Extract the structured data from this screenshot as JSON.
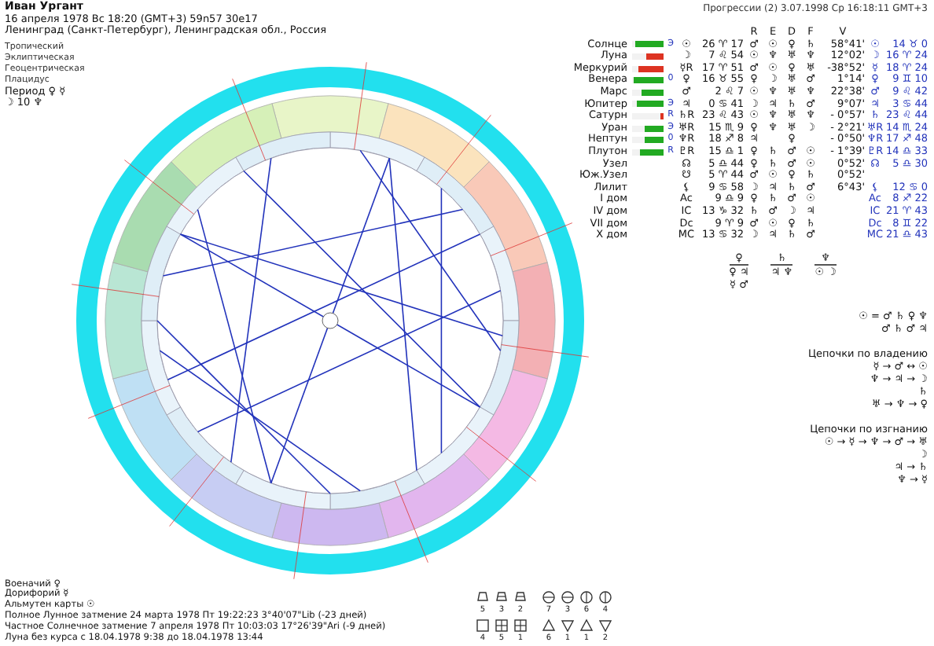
{
  "person": {
    "name": "Иван Ургант",
    "birth": "16 апреля 1978  Вс  18:20 (GMT+3) 59n57  30e17",
    "place": "Ленинград (Санкт-Петербург), Ленинградская обл., Россия"
  },
  "settings": [
    "Тропический",
    "Эклиптическая",
    "Геоцентрическая",
    "Плацидус"
  ],
  "period": {
    "label": "Период",
    "value": "♀ ☿"
  },
  "moon_day": "☽ 10 ♆",
  "progression_title": "Прогрессии (2)  3.07.1998  Ср 16:18:11 GMT+3",
  "table": {
    "columns": [
      "R",
      "E",
      "D",
      "F",
      "V"
    ],
    "rows": [
      {
        "name": "Солнце",
        "level": 0.9,
        "color": "#22aa22",
        "status": "Э",
        "glyph": "☉",
        "position": "26 ♈ 17",
        "r": "♂",
        "e": "☉",
        "d": "♀",
        "f": "♄",
        "v": "58°41'",
        "p_glyph": "☉",
        "p_position": "14 ♉ 0"
      },
      {
        "name": "Луна",
        "level": 0.55,
        "color": "#dd3322",
        "glyph": "☽",
        "position": "7 ♌ 54",
        "r": "☉",
        "e": "♆",
        "d": "♅",
        "f": "♆",
        "v": "12°02'",
        "p_glyph": "☽",
        "p_position": "16 ♈ 24"
      },
      {
        "name": "Меркурий",
        "level": 0.8,
        "color": "#dd3322",
        "glyph": "☿R",
        "position": "17 ♈ 51",
        "r": "♂",
        "e": "☉",
        "d": "♀",
        "f": "♅",
        "v": "-38°52'",
        "p_glyph": "☿",
        "p_position": "18 ♈ 24"
      },
      {
        "name": "Венера",
        "level": 0.95,
        "color": "#22aa22",
        "status": "0",
        "glyph": "♀",
        "position": "16 ♉ 55",
        "r": "♀",
        "e": "☽",
        "d": "♅",
        "f": "♂",
        "v": "1°14'",
        "p_glyph": "♀",
        "p_position": "9 ♊ 10"
      },
      {
        "name": "Марс",
        "level": 0.7,
        "color": "#22aa22",
        "glyph": "♂",
        "position": "2 ♌ 7",
        "r": "☉",
        "e": "♆",
        "d": "♅",
        "f": "♆",
        "v": "22°38'",
        "p_glyph": "♂",
        "p_position": "9 ♌ 42"
      },
      {
        "name": "Юпитер",
        "level": 0.85,
        "color": "#22aa22",
        "status": "Э",
        "glyph": "♃",
        "position": "0 ♋ 41",
        "r": "☽",
        "e": "♃",
        "d": "♄",
        "f": "♂",
        "v": "9°07'",
        "p_glyph": "♃",
        "p_position": "3 ♋ 44"
      },
      {
        "name": "Сатурн",
        "level": 0.1,
        "color": "#dd3322",
        "status": "R",
        "glyph": "♄R",
        "position": "23 ♌ 43",
        "r": "☉",
        "e": "♆",
        "d": "♅",
        "f": "♆",
        "v": "- 0°57'",
        "p_glyph": "♄",
        "p_position": "23 ♌ 44"
      },
      {
        "name": "Уран",
        "level": 0.6,
        "color": "#22aa22",
        "status": "Э",
        "glyph": "♅R",
        "position": "15 ♏ 9",
        "r": "♀",
        "e": "♆",
        "d": "♅",
        "f": "☽",
        "v": "- 2°21'",
        "p_glyph": "♅R",
        "p_position": "14 ♏ 24"
      },
      {
        "name": "Нептун",
        "level": 0.6,
        "color": "#22aa22",
        "status": "0",
        "glyph": "♆R",
        "position": "18 ♐ 8",
        "r": "♃",
        "e": "",
        "d": "♀",
        "f": "",
        "v": "- 0°50'",
        "p_glyph": "♆R",
        "p_position": "17 ♐ 48"
      },
      {
        "name": "Плутон",
        "level": 0.75,
        "color": "#22aa22",
        "status": "R",
        "glyph": "♇R",
        "position": "15 ♎ 1",
        "r": "♀",
        "e": "♄",
        "d": "♂",
        "f": "☉",
        "v": "- 1°39'",
        "p_glyph": "♇R",
        "p_position": "14 ♎ 33"
      },
      {
        "name": "Узел",
        "glyph": "☊",
        "position": "5 ♎ 44",
        "r": "♀",
        "e": "♄",
        "d": "♂",
        "f": "☉",
        "v": "0°52'",
        "p_glyph": "☊",
        "p_position": "5 ♎ 30"
      },
      {
        "name": "Юж.Узел",
        "glyph": "☋",
        "position": "5 ♈ 44",
        "r": "♂",
        "e": "☉",
        "d": "♀",
        "f": "♄",
        "v": "0°52'"
      },
      {
        "name": "Лилит",
        "glyph": "⚸",
        "position": "9 ♋ 58",
        "r": "☽",
        "e": "♃",
        "d": "♄",
        "f": "♂",
        "v": "6°43'",
        "p_glyph": "⚸",
        "p_position": "12 ♋ 0"
      },
      {
        "name": "I дом",
        "glyph": "Ac",
        "position": "9 ♎ 9",
        "r": "♀",
        "e": "♄",
        "d": "♂",
        "f": "☉",
        "p_glyph": "Ac",
        "p_position": "8 ♐ 22"
      },
      {
        "name": "IV дом",
        "glyph": "IC",
        "position": "13 ♑ 32",
        "r": "♄",
        "e": "♂",
        "d": "☽",
        "f": "♃",
        "p_glyph": "IC",
        "p_position": "21 ♈ 43"
      },
      {
        "name": "VII дом",
        "glyph": "Dc",
        "position": "9 ♈ 9",
        "r": "♂",
        "e": "☉",
        "d": "♀",
        "f": "♄",
        "p_glyph": "Dc",
        "p_position": "8 ♊ 22"
      },
      {
        "name": "X дом",
        "glyph": "MC",
        "position": "13 ♋ 32",
        "r": "☽",
        "e": "♃",
        "d": "♄",
        "f": "♂",
        "p_glyph": "MC",
        "p_position": "21 ♎ 43"
      }
    ]
  },
  "dispositors": [
    {
      "top": "♀",
      "bottom": [
        "♀ ♃",
        "☿ ♂"
      ]
    },
    {
      "top": "♄",
      "bottom": [
        "♃ ♆"
      ]
    },
    {
      "top": "♆",
      "bottom": [
        "☉ ☽"
      ]
    }
  ],
  "relations": [
    "☉ = ♂ ♄ ♀ ♆",
    "♂ ♄ ♂ ♃"
  ],
  "chains": [
    {
      "title": "Цепочки по владению",
      "lines": [
        "☿ → ♂ ↔ ☉",
        "♆ → ♃ → ☽",
        "♄",
        "♅ → ♆ → ♀"
      ]
    },
    {
      "title": "Цепочки по изгнанию",
      "lines": [
        "☉ → ☿ → ♆ → ♂ → ♅",
        "☽",
        "♃ → ♄",
        "♆ → ☿"
      ]
    }
  ],
  "counts": [
    [
      "5",
      "3",
      "2"
    ],
    [
      "7",
      "3",
      "6",
      "4"
    ],
    [
      "4",
      "5",
      "1"
    ],
    [
      "6",
      "1",
      "1",
      "2"
    ]
  ],
  "notes": [
    "Военачий ♀",
    "Дорифорий ☿",
    "Альмутен карты ☉",
    "Полное Лунное затмение 24 марта 1978 Пт 19:22:23  3°40'07\"Lib (-23 дней)",
    "Частное Солнечное затмение 7 апреля 1978 Пт 10:03:03 17°26'39\"Ari (-9 дней)",
    "Луна без курса с 18.04.1978  9:38 до 18.04.1978 13:44"
  ]
}
